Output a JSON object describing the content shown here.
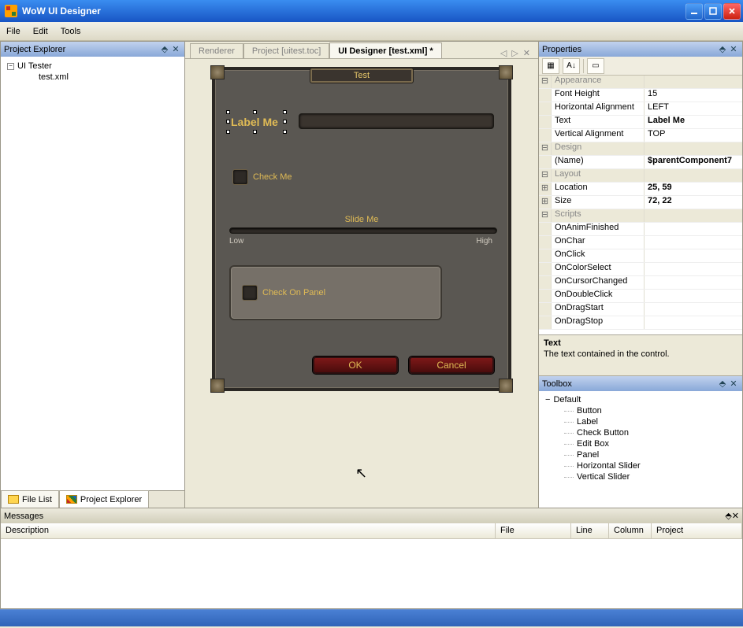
{
  "app_title": "WoW UI Designer",
  "menu": {
    "file": "File",
    "edit": "Edit",
    "tools": "Tools"
  },
  "project_explorer": {
    "title": "Project Explorer",
    "root": "UI Tester",
    "file": "test.xml",
    "tabs": {
      "filelist": "File List",
      "project_explorer": "Project Explorer"
    }
  },
  "doc_tabs": {
    "renderer": "Renderer",
    "project": "Project [uitest.toc]",
    "designer": "UI Designer [test.xml] *"
  },
  "wow": {
    "title": "Test",
    "label": "Label Me",
    "check": "Check Me",
    "slider_label": "Slide Me",
    "slider_low": "Low",
    "slider_high": "High",
    "panel_check": "Check On Panel",
    "ok": "OK",
    "cancel": "Cancel"
  },
  "properties": {
    "title": "Properties",
    "categories": {
      "appearance": "Appearance",
      "design": "Design",
      "layout": "Layout",
      "scripts": "Scripts"
    },
    "appearance": {
      "font_height": {
        "label": "Font Height",
        "value": "15"
      },
      "halign": {
        "label": "Horizontal Alignment",
        "value": "LEFT"
      },
      "text": {
        "label": "Text",
        "value": "Label Me"
      },
      "valign": {
        "label": "Vertical Alignment",
        "value": "TOP"
      }
    },
    "design": {
      "name": {
        "label": "(Name)",
        "value": "$parentComponent7"
      }
    },
    "layout": {
      "location": {
        "label": "Location",
        "value": "25, 59"
      },
      "size": {
        "label": "Size",
        "value": "72, 22"
      }
    },
    "scripts": [
      "OnAnimFinished",
      "OnChar",
      "OnClick",
      "OnColorSelect",
      "OnCursorChanged",
      "OnDoubleClick",
      "OnDragStart",
      "OnDragStop"
    ],
    "desc_title": "Text",
    "desc_text": "The text contained in the control."
  },
  "toolbox": {
    "title": "Toolbox",
    "group": "Default",
    "items": [
      "Button",
      "Label",
      "Check Button",
      "Edit Box",
      "Panel",
      "Horizontal Slider",
      "Vertical Slider"
    ]
  },
  "messages": {
    "title": "Messages",
    "cols": {
      "description": "Description",
      "file": "File",
      "line": "Line",
      "column": "Column",
      "project": "Project"
    }
  }
}
